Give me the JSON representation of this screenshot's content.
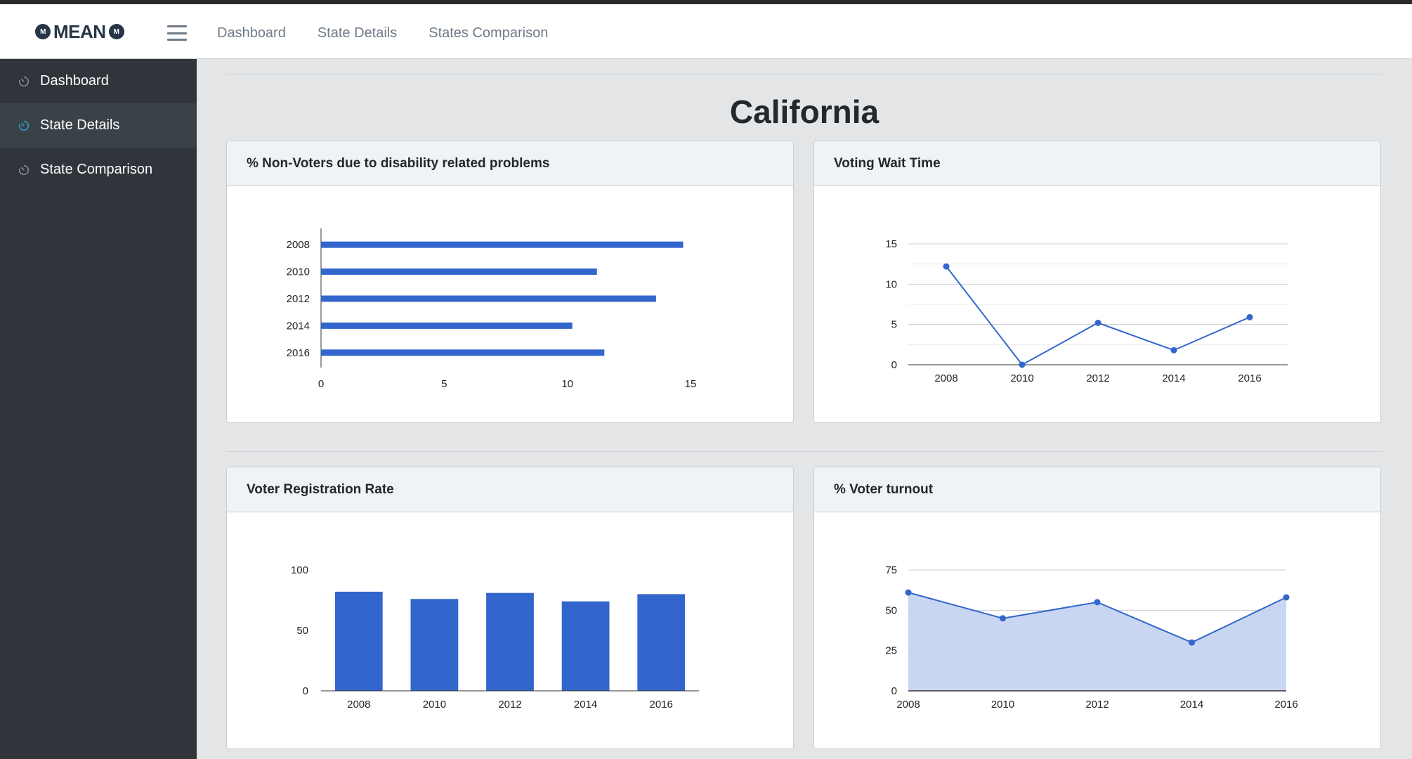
{
  "brand": {
    "name": "MEAN",
    "medal": "M"
  },
  "topnav": {
    "items": [
      "Dashboard",
      "State Details",
      "States Comparison"
    ]
  },
  "sidebar": {
    "items": [
      {
        "label": "Dashboard",
        "icon": "speedometer-icon",
        "active": false
      },
      {
        "label": "State Details",
        "icon": "speedometer-icon",
        "active": true
      },
      {
        "label": "State Comparison",
        "icon": "speedometer-icon",
        "active": false
      }
    ]
  },
  "page": {
    "title": "California"
  },
  "colors": {
    "accent": "#3366cc",
    "area_fill": "#c6d4f0",
    "sidebar_bg": "#2f353a",
    "active_icon": "#20a8d8"
  },
  "cards": {
    "disability": {
      "title": "% Non-Voters due to disability related problems"
    },
    "wait": {
      "title": "Voting Wait Time"
    },
    "registration": {
      "title": "Voter Registration Rate"
    },
    "turnout": {
      "title": "% Voter turnout"
    }
  },
  "chart_data": [
    {
      "id": "disability",
      "type": "bar",
      "orientation": "horizontal",
      "title": "% Non-Voters due to disability related problems",
      "categories": [
        "2008",
        "2010",
        "2012",
        "2014",
        "2016"
      ],
      "values": [
        14.7,
        11.2,
        13.6,
        10.2,
        11.5
      ],
      "xlim": [
        0,
        15
      ],
      "xticks": [
        0,
        5,
        10,
        15
      ],
      "grid": false,
      "color": "#3366cc"
    },
    {
      "id": "wait",
      "type": "line",
      "title": "Voting Wait Time",
      "x": [
        "2008",
        "2010",
        "2012",
        "2014",
        "2016"
      ],
      "values": [
        12.2,
        0,
        5.2,
        1.8,
        5.9
      ],
      "ylim": [
        0,
        15
      ],
      "yticks": [
        0,
        5,
        10,
        15
      ],
      "grid": true,
      "color": "#3366cc"
    },
    {
      "id": "registration",
      "type": "bar",
      "orientation": "vertical",
      "title": "Voter Registration Rate",
      "categories": [
        "2008",
        "2010",
        "2012",
        "2014",
        "2016"
      ],
      "values": [
        82,
        76,
        81,
        74,
        80
      ],
      "ylim": [
        0,
        100
      ],
      "yticks": [
        0,
        50,
        100
      ],
      "grid": false,
      "color": "#3366cc"
    },
    {
      "id": "turnout",
      "type": "area",
      "title": "% Voter turnout",
      "x": [
        "2008",
        "2010",
        "2012",
        "2014",
        "2016"
      ],
      "values": [
        61,
        45,
        55,
        30,
        58
      ],
      "ylim": [
        0,
        75
      ],
      "yticks": [
        0,
        25,
        50,
        75
      ],
      "grid": true,
      "color": "#3366cc"
    }
  ]
}
